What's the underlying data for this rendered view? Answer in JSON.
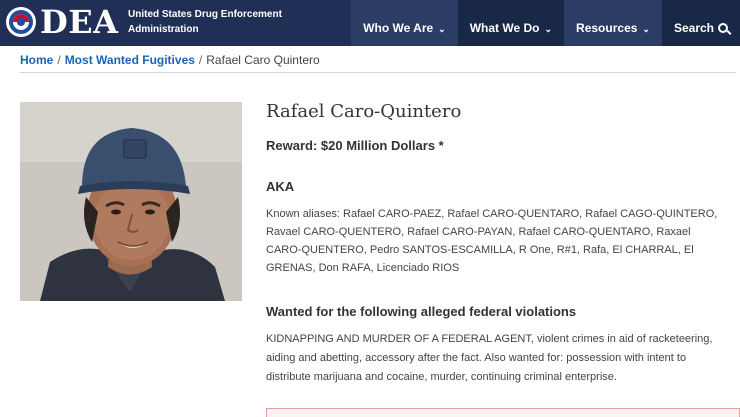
{
  "header": {
    "logo_text": "DEA",
    "agency_line1": "United States Drug Enforcement",
    "agency_line2": "Administration",
    "nav": [
      {
        "label": "Who We Are"
      },
      {
        "label": "What We Do"
      },
      {
        "label": "Resources"
      },
      {
        "label": "Search"
      }
    ]
  },
  "breadcrumb": {
    "home": "Home",
    "section": "Most Wanted Fugitives",
    "current": "Rafael Caro Quintero",
    "separator": "/"
  },
  "profile": {
    "photo_icon": "fugitive-photo",
    "name": "Rafael Caro-Quintero",
    "reward": "Reward: $20 Million Dollars *",
    "aka_heading": "AKA",
    "aliases": "Known aliases: Rafael CARO-PAEZ, Rafael CARO-QUENTARO, Rafael CAGO-QUINTERO, Ravael CARO-QUENTERO, Rafael CARO-PAYAN, Rafael CARO-QUENTARO, Raxael CARO-QUENTERO, Pedro SANTOS-ESCAMILLA, R One, R#1, Rafa, El CHARRAL, El GRENAS, Don RAFA, Licenciado RIOS",
    "wanted_heading": "Wanted for the following alleged federal violations",
    "violations": "KIDNAPPING AND MURDER OF A FEDERAL AGENT, violent crimes in aid of racketeering, aiding and abetting, accessory after the fact. Also wanted for: possession with intent to distribute marijuana and cocaine, murder, continuing criminal enterprise."
  },
  "colors": {
    "header_bg": "#1f2f55",
    "link": "#1b63b5"
  }
}
